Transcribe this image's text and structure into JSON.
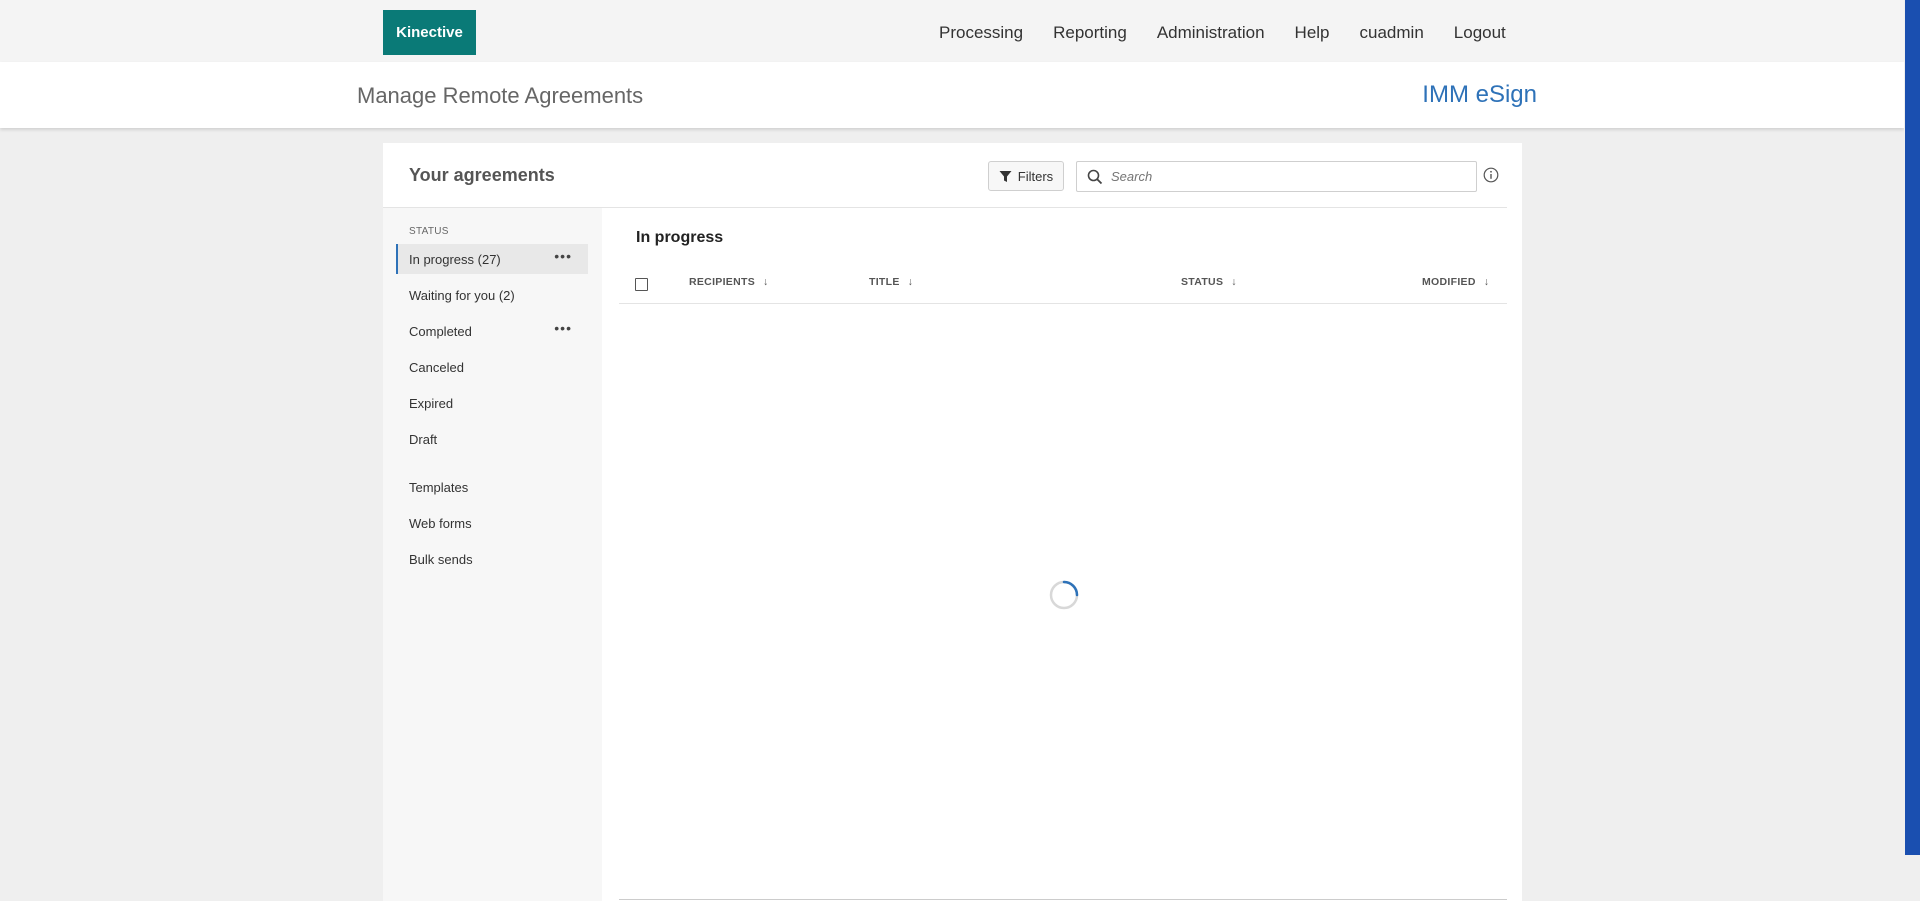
{
  "topbar": {
    "logo": "Kinective",
    "nav": [
      "Processing",
      "Reporting",
      "Administration",
      "Help",
      "cuadmin",
      "Logout"
    ]
  },
  "header": {
    "page_title": "Manage Remote Agreements",
    "app_title": "IMM eSign"
  },
  "panel": {
    "title": "Your agreements",
    "filters_label": "Filters",
    "search_placeholder": "Search"
  },
  "sidebar": {
    "status_label": "STATUS",
    "items": [
      {
        "label": "In progress (27)",
        "active": true,
        "has_menu": true
      },
      {
        "label": "Waiting for you (2)"
      },
      {
        "label": "Completed",
        "has_menu": true
      },
      {
        "label": "Canceled"
      },
      {
        "label": "Expired"
      },
      {
        "label": "Draft"
      },
      {
        "label": "Templates"
      },
      {
        "label": "Web forms"
      },
      {
        "label": "Bulk sends"
      }
    ]
  },
  "list": {
    "title": "In progress",
    "columns": [
      "RECIPIENTS",
      "TITLE",
      "STATUS",
      "MODIFIED"
    ],
    "loading": true
  },
  "colors": {
    "brand": "#0a7a77",
    "accent": "#2e72b8",
    "scrollbar": "#1a4fb0"
  }
}
